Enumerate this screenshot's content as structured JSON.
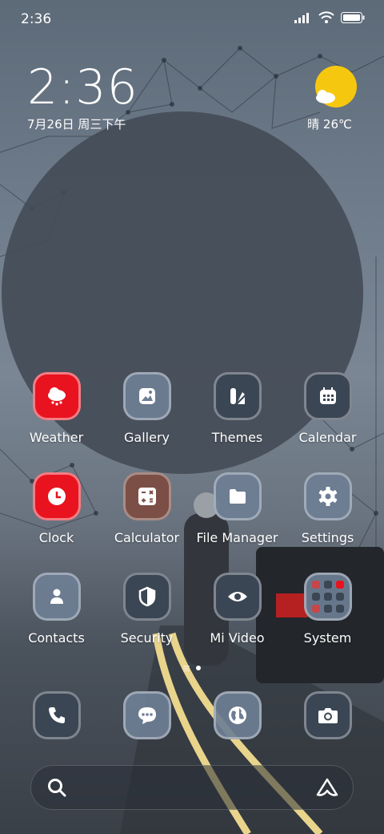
{
  "status_bar": {
    "time": "2:36"
  },
  "clock_widget": {
    "time": "2:36",
    "date": "7月26日 周三下午"
  },
  "weather_widget": {
    "text": "晴 26℃",
    "icon": "sunny-cloud-icon"
  },
  "apps": [
    {
      "label": "Weather",
      "icon": "weather-icon"
    },
    {
      "label": "Gallery",
      "icon": "gallery-icon"
    },
    {
      "label": "Themes",
      "icon": "themes-icon"
    },
    {
      "label": "Calendar",
      "icon": "calendar-icon"
    },
    {
      "label": "Clock",
      "icon": "clock-icon"
    },
    {
      "label": "Calculator",
      "icon": "calculator-icon"
    },
    {
      "label": "File Manager",
      "icon": "folder-icon"
    },
    {
      "label": "Settings",
      "icon": "gear-icon"
    },
    {
      "label": "Contacts",
      "icon": "contacts-icon"
    },
    {
      "label": "Security",
      "icon": "shield-icon"
    },
    {
      "label": "Mi Video",
      "icon": "eye-icon"
    },
    {
      "label": "System",
      "icon": "folder-grid-icon"
    }
  ],
  "dock": [
    {
      "icon": "phone-icon"
    },
    {
      "icon": "messages-icon"
    },
    {
      "icon": "browser-icon"
    },
    {
      "icon": "camera-icon"
    }
  ],
  "colors": {
    "accent_red": "#e8131f",
    "sun": "#f5c80f"
  }
}
